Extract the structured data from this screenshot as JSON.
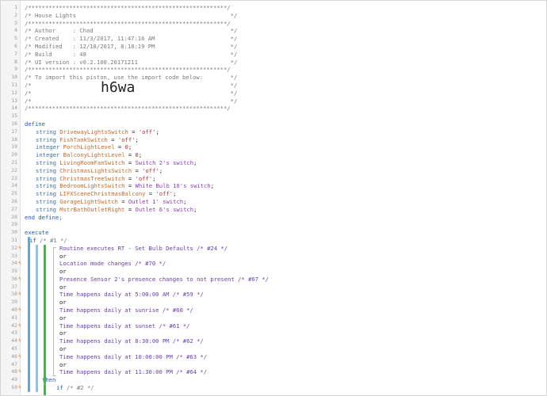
{
  "header": [
    "/**********************************************************/",
    "/* House Lights                                             */",
    "/**********************************************************/",
    "/* Author     : Chad                                        */",
    "/* Created    : 11/3/2017, 11:47:16 AM                      */",
    "/* Modified   : 12/18/2017, 8:18:19 PM                      */",
    "/* Build      : 48                                          */",
    "/* UI version : v0.2.100.20171211                           */",
    "/**********************************************************/",
    "/* To import this piston, use the import code below:        */",
    "/*                                                          */",
    "/*                                                          */",
    "/*                                                          */",
    "/**********************************************************/"
  ],
  "import_code": "h6wa",
  "define_keyword": "define",
  "end_define": "end define;",
  "vars": [
    {
      "type": "string",
      "name": "DrivewayLightsSwitch",
      "value": "'off'"
    },
    {
      "type": "string",
      "name": "FishTankSwitch",
      "value": "'off'"
    },
    {
      "type": "integer",
      "name": "PorchLightLevel",
      "value": "0"
    },
    {
      "type": "integer",
      "name": "BalconyLightsLevel",
      "value": "0"
    },
    {
      "type": "string",
      "name": "LivingRoomFanSwitch",
      "value": "Switch 2's switch"
    },
    {
      "type": "string",
      "name": "ChristmasLightsSwitch",
      "value": "'off'"
    },
    {
      "type": "string",
      "name": "ChristmasTreeSwitch",
      "value": "'off'"
    },
    {
      "type": "string",
      "name": "BedroomLightsSwitch",
      "value": "White Bulb 10's switch"
    },
    {
      "type": "string",
      "name": "LIFXSceneChristmasBalcony",
      "value": "'off'"
    },
    {
      "type": "string",
      "name": "GarageLightSwitch",
      "value": "Outlet 1' switch"
    },
    {
      "type": "string",
      "name": "MstrBathOutletRight",
      "value": "Outlet 6's switch"
    }
  ],
  "execute_keyword": "execute",
  "if_line": "if /* #1 */",
  "conditions": [
    "Routine executes RT - Set Bulb Defaults /* #24 */",
    "or",
    "Location mode changes /* #70 */",
    "or",
    "Presence Sensor 2's presence changes to not present /* #67 */",
    "or",
    "Time happens daily at 5:00:00 AM /* #59 */",
    "or",
    "Time happens daily at sunrise /* #60 */",
    "or",
    "Time happens daily at sunset /* #61 */",
    "or",
    "Time happens daily at 8:30:00 PM /* #62 */",
    "or",
    "Time happens daily at 10:00:00 PM /* #63 */",
    "or",
    "Time happens daily at 11:30:00 PM /* #64 */"
  ],
  "then_keyword": "then",
  "inner_if": "if /* #2 */",
  "line_numbers": [
    "1",
    "2",
    "3",
    "4",
    "5",
    "6",
    "7",
    "8",
    "9",
    "10",
    "11",
    "12",
    "13",
    "14",
    "15",
    "16",
    "17",
    "18",
    "19",
    "20",
    "21",
    "22",
    "23",
    "24",
    "25",
    "26",
    "27",
    "28",
    "29",
    "30",
    "31",
    "32",
    "33",
    "34",
    "35",
    "36",
    "37",
    "38",
    "39",
    "40",
    "41",
    "42",
    "43",
    "44",
    "45",
    "46",
    "47",
    "48",
    "49",
    "50"
  ],
  "bolt_marker": "ϟ"
}
